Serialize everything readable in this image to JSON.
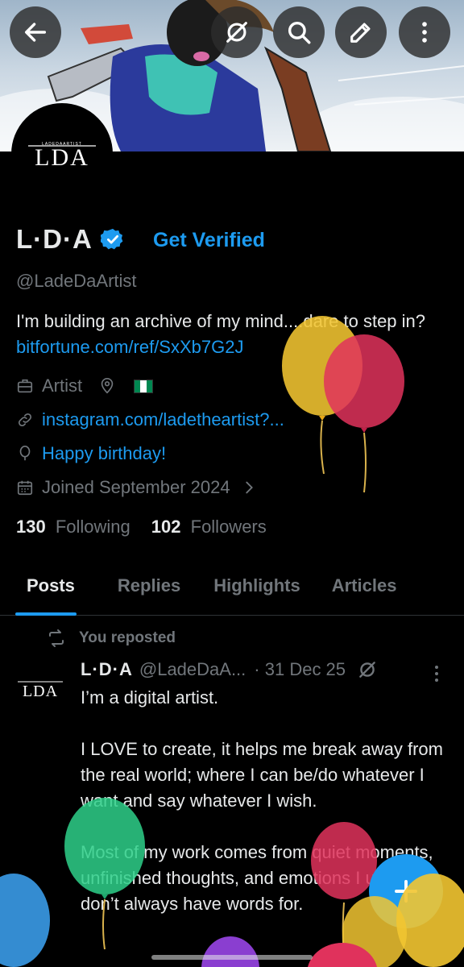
{
  "profile": {
    "name": "L·D·A",
    "get_verified": "Get Verified",
    "handle": "@LadeDaArtist",
    "bio_text": "I'm building an archive of my mind....dare to step in?",
    "bio_link": "bitfortune.com/ref/SxXb7G2J",
    "profession": "Artist",
    "website": "instagram.com/ladetheartist?...",
    "birthday": "Happy birthday!",
    "joined": "Joined September 2024",
    "following_count": "130",
    "following_label": "Following",
    "followers_count": "102",
    "followers_label": "Followers",
    "avatar_logo_text": "LDA",
    "avatar_logo_subtext": "LADEDAARTIST"
  },
  "tabs": [
    {
      "label": "Posts",
      "active": true
    },
    {
      "label": "Replies",
      "active": false
    },
    {
      "label": "Highlights",
      "active": false
    },
    {
      "label": "Articles",
      "active": false
    }
  ],
  "post": {
    "repost_label": "You reposted",
    "author_name": "L·D·A",
    "author_handle": "@LadeDaA...",
    "date": "· 31 Dec 25",
    "paragraphs": [
      "I’m a digital artist.",
      "I LOVE to create, it helps me break away from the real world; where I can be/do whatever I want and say whatever I wish.",
      "Most of my work comes from quiet moments, unfinished thoughts, and emotions I usually don’t always have words for."
    ]
  },
  "icons": {
    "back": "arrow-left-icon",
    "grok": "grok-icon",
    "search": "search-icon",
    "edit": "edit-icon",
    "more": "more-vertical-icon",
    "verified": "verified-badge-icon",
    "briefcase": "briefcase-icon",
    "location": "location-pin-icon",
    "link": "link-icon",
    "balloon": "balloon-icon",
    "calendar": "calendar-icon",
    "chevron": "chevron-right-icon",
    "repost": "repost-icon",
    "compose": "plus-icon"
  },
  "colors": {
    "accent": "#1d9bf0",
    "text": "#e7e9ea",
    "muted": "#71767b",
    "background": "#000000"
  }
}
